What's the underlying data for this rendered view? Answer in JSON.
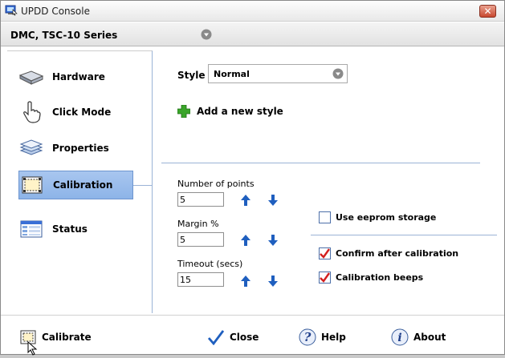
{
  "window": {
    "title": "UPDD Console",
    "close_glyph": "✕"
  },
  "device": {
    "label": "DMC, TSC-10 Series"
  },
  "nav": {
    "items": [
      {
        "label": "Hardware",
        "icon": "hardware-icon"
      },
      {
        "label": "Click Mode",
        "icon": "hand-pointer-icon"
      },
      {
        "label": "Properties",
        "icon": "layers-icon"
      },
      {
        "label": "Calibration",
        "icon": "calibration-icon",
        "active": true
      },
      {
        "label": "Status",
        "icon": "status-table-icon"
      }
    ]
  },
  "style": {
    "label": "Style",
    "value": "Normal"
  },
  "add_style": {
    "label": "Add a new style"
  },
  "fields": {
    "points": {
      "label": "Number of points",
      "value": "5"
    },
    "margin": {
      "label": "Margin %",
      "value": "5"
    },
    "timeout": {
      "label": "Timeout (secs)",
      "value": "15"
    }
  },
  "checks": {
    "eeprom": {
      "label": "Use eeprom storage",
      "checked": false
    },
    "confirm": {
      "label": "Confirm after calibration",
      "checked": true
    },
    "beeps": {
      "label": "Calibration beeps",
      "checked": true
    }
  },
  "bottom": {
    "calibrate": "Calibrate",
    "close": "Close",
    "help": "Help",
    "about": "About"
  },
  "colors": {
    "accent": "#8db4e8",
    "arrow_blue": "#1f5fbf",
    "check_red": "#d21f1f",
    "plus_green": "#3aa52a"
  }
}
